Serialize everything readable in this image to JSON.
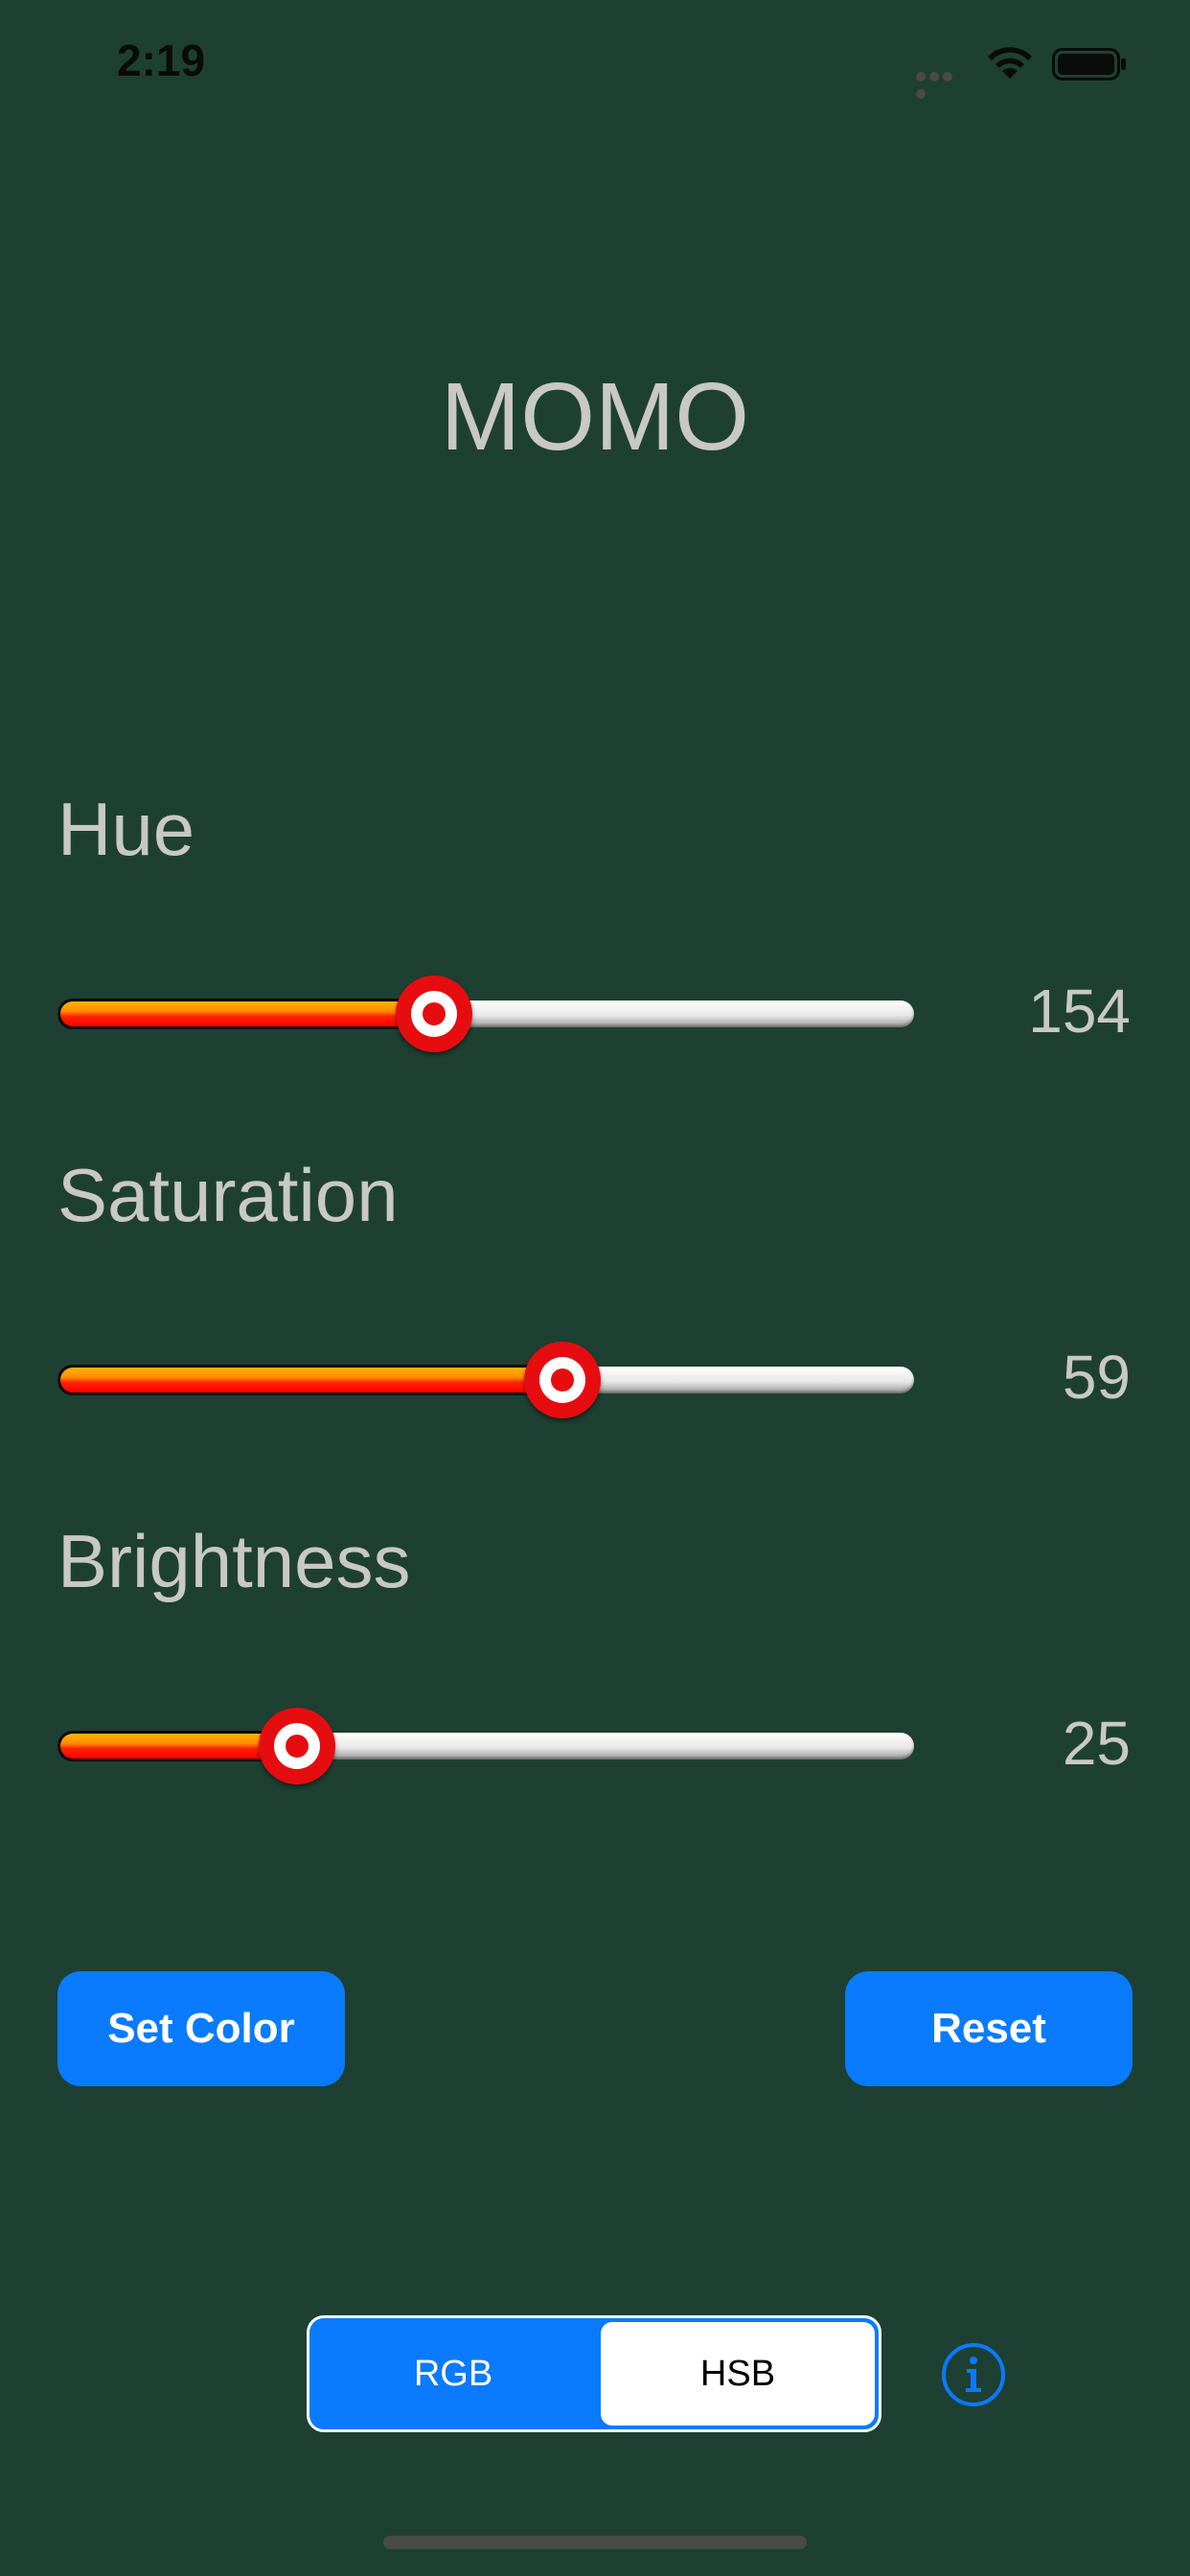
{
  "status_bar": {
    "time": "2:19",
    "icons": [
      "cellular-signal-icon",
      "wifi-icon",
      "battery-icon"
    ]
  },
  "app": {
    "title": "MOMO"
  },
  "sliders": [
    {
      "label": "Hue",
      "value": "154",
      "fraction": 0.44
    },
    {
      "label": "Saturation",
      "value": "59",
      "fraction": 0.59
    },
    {
      "label": "Brightness",
      "value": "25",
      "fraction": 0.28
    }
  ],
  "buttons": {
    "set_color": "Set Color",
    "reset": "Reset"
  },
  "mode_selector": {
    "options": [
      "RGB",
      "HSB"
    ],
    "selected": "HSB"
  },
  "colors": {
    "background": "#1e4032",
    "accent": "#0a7aff",
    "text": "#c8c8c6",
    "slider_thumb": "#e60d10"
  }
}
